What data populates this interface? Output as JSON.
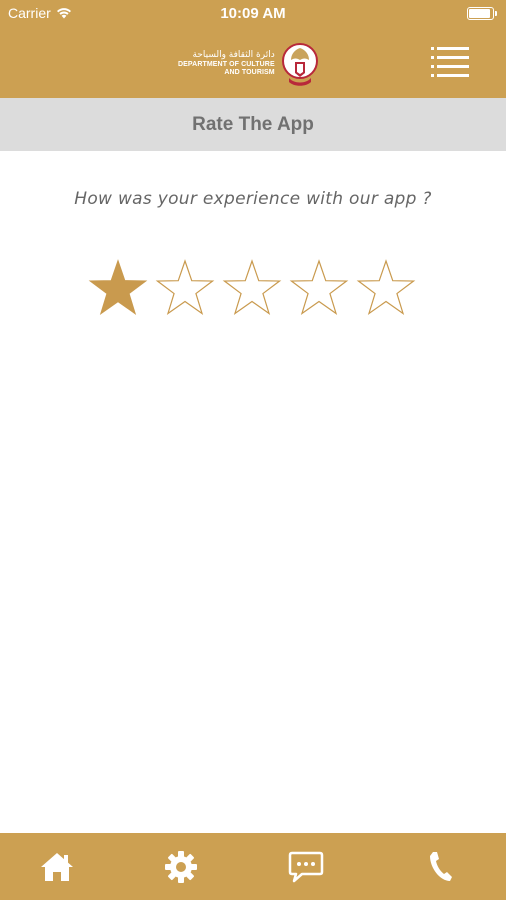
{
  "status_bar": {
    "carrier": "Carrier",
    "time": "10:09 AM"
  },
  "header": {
    "logo_arabic": "دائرة الثقافة والسياحة",
    "logo_line1": "DEPARTMENT OF CULTURE",
    "logo_line2": "AND TOURISM",
    "menu_icon": "hamburger-menu-icon"
  },
  "page": {
    "title": "Rate The App",
    "question": "How was your experience with our app ?"
  },
  "rating": {
    "value": 1,
    "max": 5
  },
  "tab_bar": {
    "tabs": [
      "home-icon",
      "settings-gear-icon",
      "chat-bubble-icon",
      "phone-icon"
    ]
  },
  "colors": {
    "brand_gold": "#cca052",
    "star_fill": "#c99a4e",
    "title_bar_bg": "#dcdcdc",
    "title_text": "#717171",
    "question_text": "#666666"
  }
}
